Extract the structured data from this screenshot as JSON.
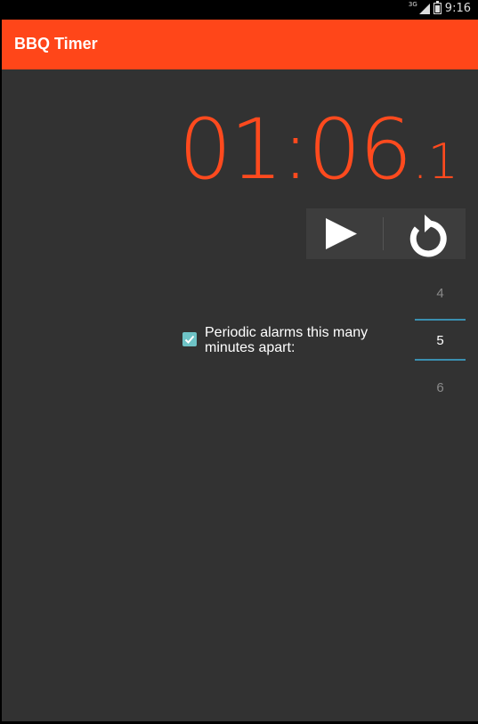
{
  "status_bar": {
    "network": "3G",
    "time": "9:16",
    "icons": [
      "signal-icon",
      "battery-icon"
    ]
  },
  "app_bar": {
    "title": "BBQ Timer",
    "color": "#ff4619"
  },
  "timer": {
    "main": "01:06",
    "tenths": ".1",
    "color": "#ff4a1e"
  },
  "controls": {
    "play_icon": "play-icon",
    "reset_icon": "reset-icon"
  },
  "alarm": {
    "checked": true,
    "label": "Periodic alarms this many minutes apart:"
  },
  "picker": {
    "previous": "4",
    "current": "5",
    "next": "6",
    "accent": "#3a8fb0"
  },
  "colors": {
    "background": "#323232",
    "checkbox": "#6ec3c6"
  }
}
